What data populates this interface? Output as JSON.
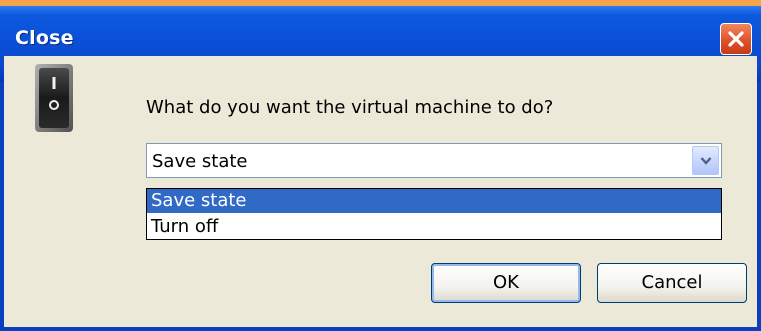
{
  "window": {
    "title": "Close",
    "close_icon": "close-icon",
    "accent": "#0a4fd6",
    "face": "#ece9d8"
  },
  "dialog": {
    "icon": "power-switch-icon",
    "prompt": "What do you want the virtual machine to do?",
    "select": {
      "value": "Save state",
      "arrow_icon": "chevron-down-icon",
      "options": [
        "Save state",
        "Turn off"
      ],
      "highlighted": "Save state",
      "highlight_color": "#316ac5"
    },
    "buttons": {
      "ok": "OK",
      "cancel": "Cancel"
    }
  }
}
